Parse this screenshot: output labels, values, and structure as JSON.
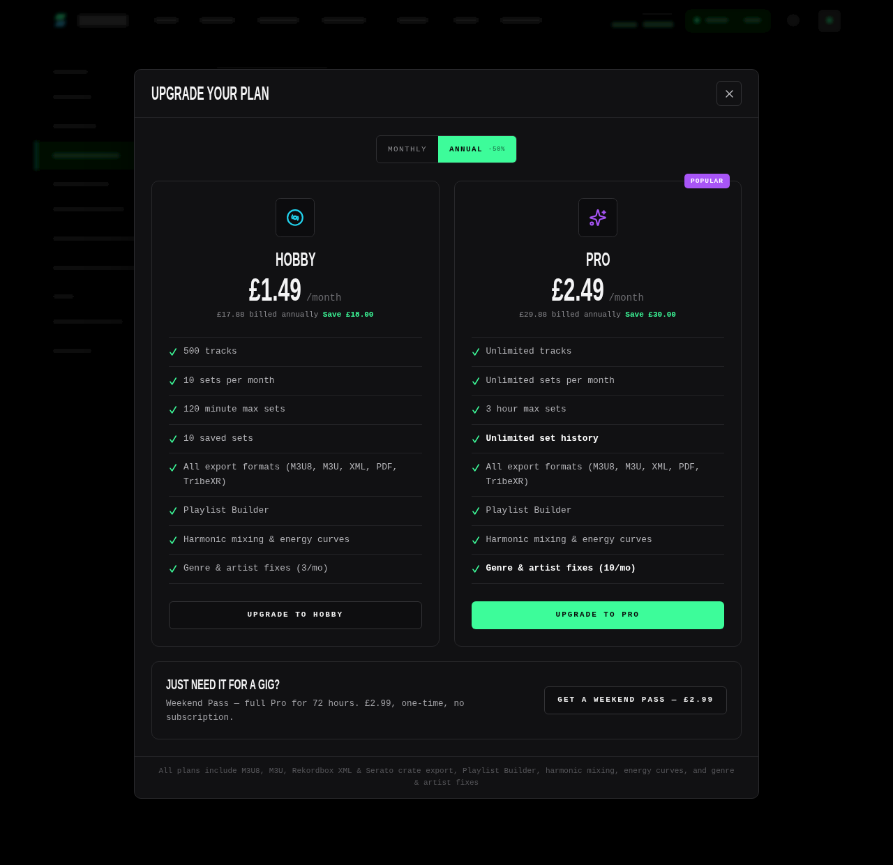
{
  "modal": {
    "title": "UPGRADE YOUR PLAN"
  },
  "billing_toggle": [
    {
      "label": "MONTHLY",
      "selected": false
    },
    {
      "label": "ANNUAL",
      "badge": "-50%",
      "selected": true
    }
  ],
  "plans": [
    {
      "kind": "hobby",
      "color": "#22d3ee",
      "name": "HOBBY",
      "price": "£1.49",
      "period": "/month",
      "billing": "£17.88 billed annually **Save £18.00**",
      "features": [
        {
          "text": "500 tracks",
          "highlighted": false
        },
        {
          "text": "10 sets per month",
          "highlighted": false
        },
        {
          "text": "120 minute max sets",
          "highlighted": false
        },
        {
          "text": "10 saved sets",
          "highlighted": false
        },
        {
          "text": "All export formats (M3U8, M3U, XML, PDF, TribeXR)",
          "highlighted": false
        },
        {
          "text": "Playlist Builder",
          "highlighted": false
        },
        {
          "text": "Harmonic mixing & energy curves",
          "highlighted": false
        },
        {
          "text": "Genre & artist fixes (3/mo)",
          "highlighted": false
        }
      ],
      "button": {
        "label": "UPGRADE TO HOBBY",
        "kind": "outline"
      }
    },
    {
      "kind": "pro",
      "color": "#a855f7",
      "badge": "POPULAR",
      "name": "PRO",
      "price": "£2.49",
      "period": "/month",
      "billing": "£29.88 billed annually **Save £30.00**",
      "features": [
        {
          "text": "Unlimited tracks",
          "highlighted": false
        },
        {
          "text": "Unlimited sets per month",
          "highlighted": false
        },
        {
          "text": "3 hour max sets",
          "highlighted": false
        },
        {
          "text": "Unlimited set history",
          "highlighted": true
        },
        {
          "text": "All export formats (M3U8, M3U, XML, PDF, TribeXR)",
          "highlighted": false
        },
        {
          "text": "Playlist Builder",
          "highlighted": false
        },
        {
          "text": "Harmonic mixing & energy curves",
          "highlighted": false
        },
        {
          "text": "Genre & artist fixes (10/mo)",
          "highlighted": true
        }
      ],
      "button": {
        "label": "UPGRADE TO PRO",
        "kind": "filled"
      }
    }
  ],
  "weekend_pass": {
    "title": "JUST NEED IT FOR A GIG?",
    "description": "Weekend Pass — full Pro for 72 hours. £2.99, one-time, no subscription.",
    "button": "GET A WEEKEND PASS — £2.99"
  },
  "footnote": "All plans include M3U8, M3U, Rekordbox XML & Serato crate export, Playlist Builder, harmonic mixing, energy curves, and genre & artist fixes"
}
